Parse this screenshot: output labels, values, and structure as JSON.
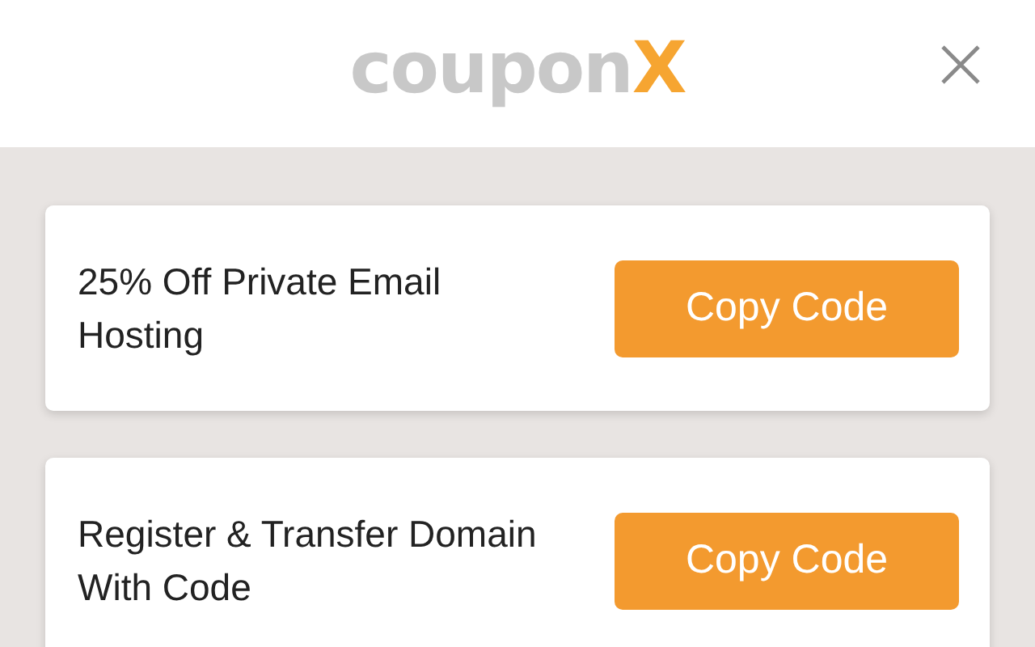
{
  "logo": {
    "word": "coupon",
    "mark": "X"
  },
  "coupons": [
    {
      "title": "25% Off Private Email Hosting",
      "button": "Copy Code"
    },
    {
      "title": "Register & Transfer Domain With Code",
      "button": "Copy Code"
    }
  ]
}
